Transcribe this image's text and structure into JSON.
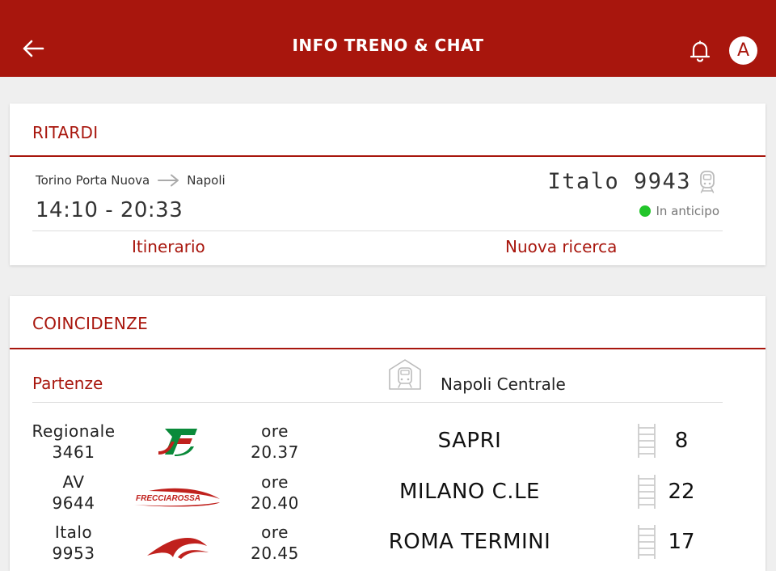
{
  "header": {
    "title": "INFO TRENO & CHAT",
    "avatar_letter": "A"
  },
  "ritardi": {
    "title": "RITARDI",
    "from": "Torino Porta Nuova",
    "to": "Napoli",
    "times": "14:10 - 20:33",
    "train": "Italo 9943",
    "status": "In anticipo",
    "status_color": "#22c52a",
    "link_itinerario": "Itinerario",
    "link_nuova_ricerca": "Nuova ricerca"
  },
  "coincidenze": {
    "title": "COINCIDENZE",
    "partenze_label": "Partenze",
    "station": "Napoli Centrale",
    "rows": [
      {
        "category": "Regionale",
        "number": "3461",
        "logo": "trenitalia-fs-logo",
        "ore_label": "ore",
        "time": "20.37",
        "destination": "SAPRI",
        "track": "8"
      },
      {
        "category": "AV",
        "number": "9644",
        "logo": "frecciarossa-logo",
        "ore_label": "ore",
        "time": "20.40",
        "destination": "MILANO C.LE",
        "track": "22"
      },
      {
        "category": "Italo",
        "number": "9953",
        "logo": "italo-logo",
        "ore_label": "ore",
        "time": "20.45",
        "destination": "ROMA TERMINI",
        "track": "17"
      }
    ]
  },
  "colors": {
    "brand_red": "#a8160d",
    "background": "#efefef"
  }
}
